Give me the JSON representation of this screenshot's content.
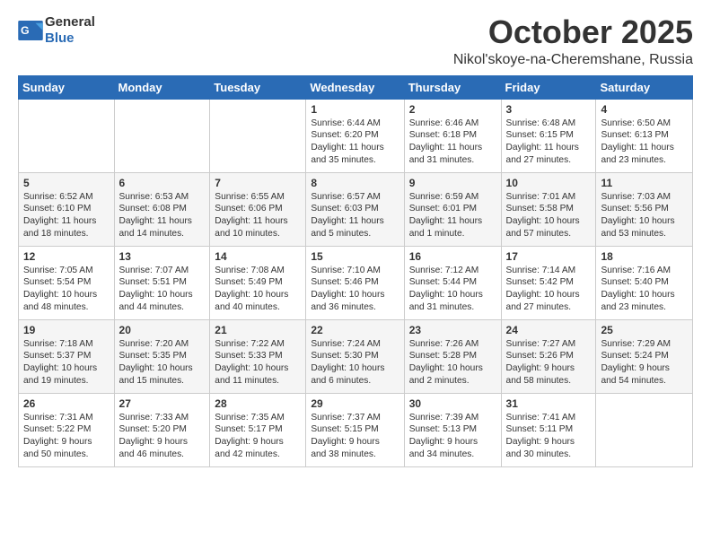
{
  "header": {
    "logo_general": "General",
    "logo_blue": "Blue",
    "month": "October 2025",
    "location": "Nikol'skoye-na-Cheremshane, Russia"
  },
  "weekdays": [
    "Sunday",
    "Monday",
    "Tuesday",
    "Wednesday",
    "Thursday",
    "Friday",
    "Saturday"
  ],
  "weeks": [
    [
      {
        "day": "",
        "info": ""
      },
      {
        "day": "",
        "info": ""
      },
      {
        "day": "",
        "info": ""
      },
      {
        "day": "1",
        "info": "Sunrise: 6:44 AM\nSunset: 6:20 PM\nDaylight: 11 hours\nand 35 minutes."
      },
      {
        "day": "2",
        "info": "Sunrise: 6:46 AM\nSunset: 6:18 PM\nDaylight: 11 hours\nand 31 minutes."
      },
      {
        "day": "3",
        "info": "Sunrise: 6:48 AM\nSunset: 6:15 PM\nDaylight: 11 hours\nand 27 minutes."
      },
      {
        "day": "4",
        "info": "Sunrise: 6:50 AM\nSunset: 6:13 PM\nDaylight: 11 hours\nand 23 minutes."
      }
    ],
    [
      {
        "day": "5",
        "info": "Sunrise: 6:52 AM\nSunset: 6:10 PM\nDaylight: 11 hours\nand 18 minutes."
      },
      {
        "day": "6",
        "info": "Sunrise: 6:53 AM\nSunset: 6:08 PM\nDaylight: 11 hours\nand 14 minutes."
      },
      {
        "day": "7",
        "info": "Sunrise: 6:55 AM\nSunset: 6:06 PM\nDaylight: 11 hours\nand 10 minutes."
      },
      {
        "day": "8",
        "info": "Sunrise: 6:57 AM\nSunset: 6:03 PM\nDaylight: 11 hours\nand 5 minutes."
      },
      {
        "day": "9",
        "info": "Sunrise: 6:59 AM\nSunset: 6:01 PM\nDaylight: 11 hours\nand 1 minute."
      },
      {
        "day": "10",
        "info": "Sunrise: 7:01 AM\nSunset: 5:58 PM\nDaylight: 10 hours\nand 57 minutes."
      },
      {
        "day": "11",
        "info": "Sunrise: 7:03 AM\nSunset: 5:56 PM\nDaylight: 10 hours\nand 53 minutes."
      }
    ],
    [
      {
        "day": "12",
        "info": "Sunrise: 7:05 AM\nSunset: 5:54 PM\nDaylight: 10 hours\nand 48 minutes."
      },
      {
        "day": "13",
        "info": "Sunrise: 7:07 AM\nSunset: 5:51 PM\nDaylight: 10 hours\nand 44 minutes."
      },
      {
        "day": "14",
        "info": "Sunrise: 7:08 AM\nSunset: 5:49 PM\nDaylight: 10 hours\nand 40 minutes."
      },
      {
        "day": "15",
        "info": "Sunrise: 7:10 AM\nSunset: 5:46 PM\nDaylight: 10 hours\nand 36 minutes."
      },
      {
        "day": "16",
        "info": "Sunrise: 7:12 AM\nSunset: 5:44 PM\nDaylight: 10 hours\nand 31 minutes."
      },
      {
        "day": "17",
        "info": "Sunrise: 7:14 AM\nSunset: 5:42 PM\nDaylight: 10 hours\nand 27 minutes."
      },
      {
        "day": "18",
        "info": "Sunrise: 7:16 AM\nSunset: 5:40 PM\nDaylight: 10 hours\nand 23 minutes."
      }
    ],
    [
      {
        "day": "19",
        "info": "Sunrise: 7:18 AM\nSunset: 5:37 PM\nDaylight: 10 hours\nand 19 minutes."
      },
      {
        "day": "20",
        "info": "Sunrise: 7:20 AM\nSunset: 5:35 PM\nDaylight: 10 hours\nand 15 minutes."
      },
      {
        "day": "21",
        "info": "Sunrise: 7:22 AM\nSunset: 5:33 PM\nDaylight: 10 hours\nand 11 minutes."
      },
      {
        "day": "22",
        "info": "Sunrise: 7:24 AM\nSunset: 5:30 PM\nDaylight: 10 hours\nand 6 minutes."
      },
      {
        "day": "23",
        "info": "Sunrise: 7:26 AM\nSunset: 5:28 PM\nDaylight: 10 hours\nand 2 minutes."
      },
      {
        "day": "24",
        "info": "Sunrise: 7:27 AM\nSunset: 5:26 PM\nDaylight: 9 hours\nand 58 minutes."
      },
      {
        "day": "25",
        "info": "Sunrise: 7:29 AM\nSunset: 5:24 PM\nDaylight: 9 hours\nand 54 minutes."
      }
    ],
    [
      {
        "day": "26",
        "info": "Sunrise: 7:31 AM\nSunset: 5:22 PM\nDaylight: 9 hours\nand 50 minutes."
      },
      {
        "day": "27",
        "info": "Sunrise: 7:33 AM\nSunset: 5:20 PM\nDaylight: 9 hours\nand 46 minutes."
      },
      {
        "day": "28",
        "info": "Sunrise: 7:35 AM\nSunset: 5:17 PM\nDaylight: 9 hours\nand 42 minutes."
      },
      {
        "day": "29",
        "info": "Sunrise: 7:37 AM\nSunset: 5:15 PM\nDaylight: 9 hours\nand 38 minutes."
      },
      {
        "day": "30",
        "info": "Sunrise: 7:39 AM\nSunset: 5:13 PM\nDaylight: 9 hours\nand 34 minutes."
      },
      {
        "day": "31",
        "info": "Sunrise: 7:41 AM\nSunset: 5:11 PM\nDaylight: 9 hours\nand 30 minutes."
      },
      {
        "day": "",
        "info": ""
      }
    ]
  ]
}
